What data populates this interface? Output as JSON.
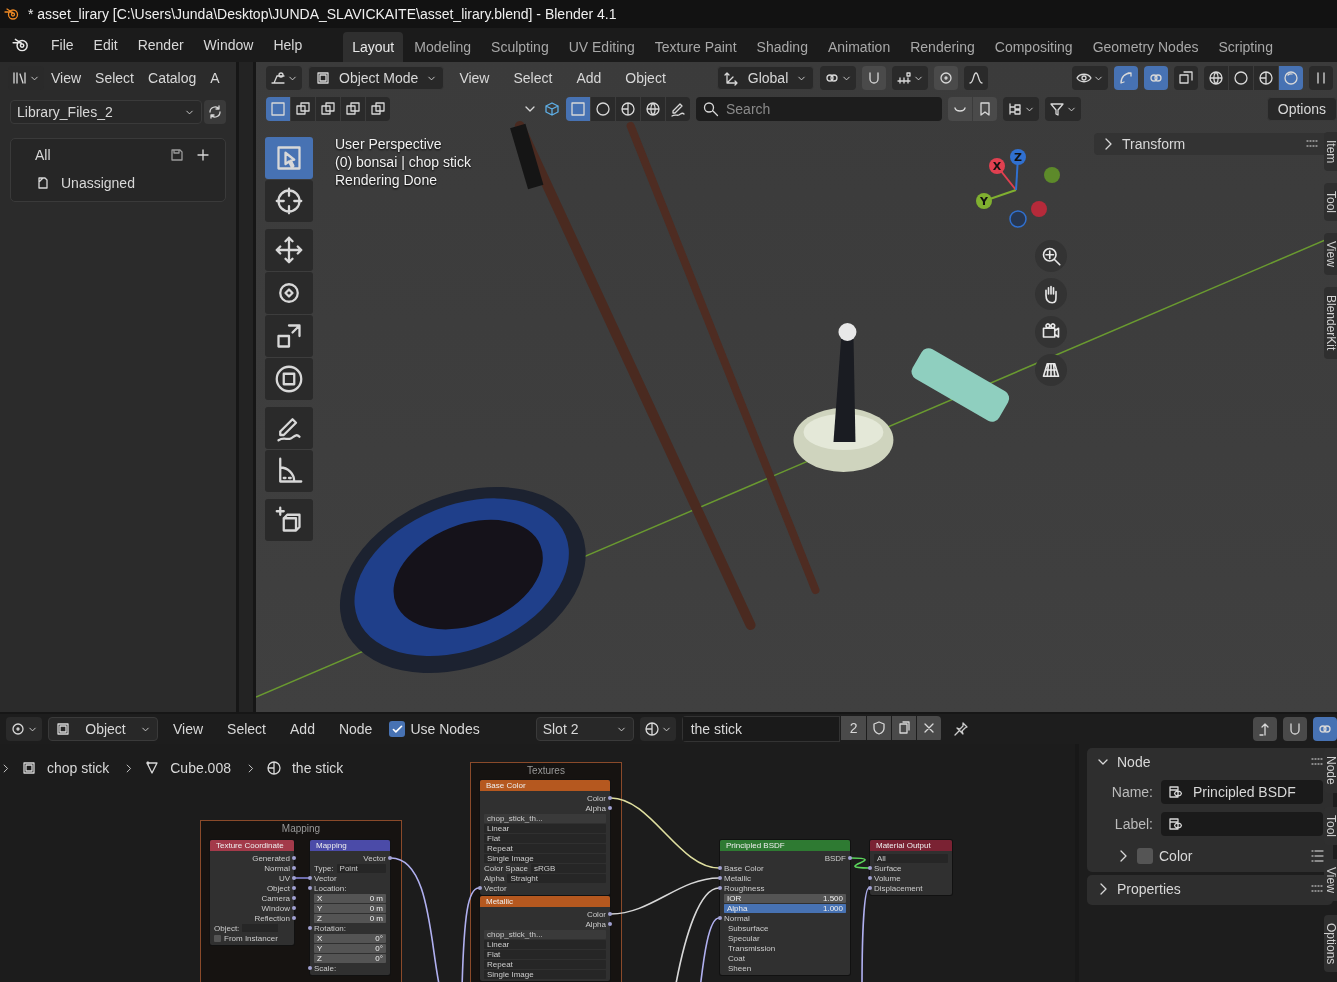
{
  "window": {
    "title": "* asset_lirary [C:\\Users\\Junda\\Desktop\\JUNDA_SLAVICKAITE\\asset_lirary.blend] - Blender 4.1"
  },
  "menu": [
    "File",
    "Edit",
    "Render",
    "Window",
    "Help"
  ],
  "workspaces": [
    {
      "label": "Layout",
      "selected": true
    },
    {
      "label": "Modeling",
      "selected": false
    },
    {
      "label": "Sculpting",
      "selected": false
    },
    {
      "label": "UV Editing",
      "selected": false
    },
    {
      "label": "Texture Paint",
      "selected": false
    },
    {
      "label": "Shading",
      "selected": false
    },
    {
      "label": "Animation",
      "selected": false
    },
    {
      "label": "Rendering",
      "selected": false
    },
    {
      "label": "Compositing",
      "selected": false
    },
    {
      "label": "Geometry Nodes",
      "selected": false
    },
    {
      "label": "Scripting",
      "selected": false
    }
  ],
  "asset_browser": {
    "menus": [
      "View",
      "Select",
      "Catalog",
      "A"
    ],
    "library": "Library_Files_2",
    "catalogs": [
      {
        "label": "All"
      },
      {
        "label": "Unassigned"
      }
    ]
  },
  "viewport": {
    "mode": "Object Mode",
    "menus": [
      "View",
      "Select",
      "Add",
      "Object"
    ],
    "orientation": "Global",
    "toggles": [
      {
        "kind": "gizmo",
        "on": true
      },
      {
        "kind": "overlay",
        "on": true
      },
      {
        "kind": "xray",
        "on": false
      }
    ],
    "shading": [
      {
        "kind": "wireframe",
        "selected": false
      },
      {
        "kind": "solid",
        "selected": false
      },
      {
        "kind": "material",
        "selected": false
      },
      {
        "kind": "rendered",
        "selected": true
      }
    ],
    "select_modes": [
      {
        "selected": true
      },
      {
        "selected": false
      },
      {
        "selected": false
      },
      {
        "selected": false
      },
      {
        "selected": false
      }
    ],
    "filters": [
      {
        "selected": true
      },
      {
        "selected": false
      },
      {
        "selected": false
      },
      {
        "selected": false
      },
      {
        "selected": false
      }
    ],
    "search": {
      "placeholder": "Search"
    },
    "options": "Options",
    "overlay_text": [
      "User Perspective",
      "(0) bonsai | chop stick",
      "Rendering Done"
    ],
    "tools": [
      {
        "kind": "select",
        "selected": true
      },
      {
        "kind": "cursor",
        "selected": false
      },
      {
        "kind": "move",
        "selected": false
      },
      {
        "kind": "rotate",
        "selected": false
      },
      {
        "kind": "scale",
        "selected": false
      },
      {
        "kind": "transform",
        "selected": false
      },
      {
        "kind": "annotate",
        "selected": false
      },
      {
        "kind": "measure",
        "selected": false
      },
      {
        "kind": "add",
        "selected": false
      }
    ],
    "gizmo_axes": [
      "X",
      "Y",
      "Z"
    ],
    "sidebar": {
      "panel": "Transform",
      "expanded": false
    },
    "tabs": [
      "Item",
      "Tool",
      "View",
      "BlenderKit"
    ]
  },
  "node_editor": {
    "type": "Object",
    "menus": [
      "View",
      "Select",
      "Add",
      "Node"
    ],
    "use_nodes": {
      "label": "Use Nodes",
      "checked": true
    },
    "slot": "Slot 2",
    "material": "the stick",
    "users": "2",
    "toggles": [
      {
        "kind": "snap",
        "on": false
      },
      {
        "kind": "overlay",
        "on": true
      }
    ],
    "breadcrumb": [
      "chop stick",
      "Cube.008",
      "the stick"
    ],
    "frames": [
      "Mapping",
      "Textures"
    ],
    "nodes": [
      {
        "title": "Texture Coordinate",
        "color": "#a33a4a",
        "rows": [
          {
            "kind": "output",
            "label": "Generated"
          },
          {
            "kind": "output",
            "label": "Normal"
          },
          {
            "kind": "output",
            "label": "UV"
          },
          {
            "kind": "output",
            "label": "Object"
          },
          {
            "kind": "output",
            "label": "Camera"
          },
          {
            "kind": "output",
            "label": "Window"
          },
          {
            "kind": "output",
            "label": "Reflection"
          },
          {
            "kind": "object",
            "label": "Object:"
          },
          {
            "kind": "check",
            "label": "From Instancer",
            "checked": false
          }
        ]
      },
      {
        "title": "Mapping",
        "color": "#4b4ba8",
        "rows": [
          {
            "kind": "output",
            "label": "Vector"
          },
          {
            "kind": "select",
            "label": "Type:",
            "value": "Point"
          },
          {
            "kind": "input",
            "label": "Vector"
          },
          {
            "kind": "input",
            "label": "Location:"
          },
          {
            "kind": "value",
            "label": "X",
            "value": "0 m"
          },
          {
            "kind": "value",
            "label": "Y",
            "value": "0 m"
          },
          {
            "kind": "value",
            "label": "Z",
            "value": "0 m"
          },
          {
            "kind": "input",
            "label": "Rotation:"
          },
          {
            "kind": "value",
            "label": "X",
            "value": "0°"
          },
          {
            "kind": "value",
            "label": "Y",
            "value": "0°"
          },
          {
            "kind": "value",
            "label": "Z",
            "value": "0°"
          },
          {
            "kind": "input",
            "label": "Scale:"
          }
        ]
      },
      {
        "title": "Base Color",
        "color": "#b5581f",
        "rows": [
          {
            "kind": "output",
            "label": "Color"
          },
          {
            "kind": "output",
            "label": "Alpha"
          },
          {
            "kind": "image",
            "value": "chop_stick_th..."
          },
          {
            "kind": "select",
            "value": "Linear"
          },
          {
            "kind": "select",
            "value": "Flat"
          },
          {
            "kind": "select",
            "value": "Repeat"
          },
          {
            "kind": "select",
            "value": "Single Image"
          },
          {
            "kind": "select",
            "label": "Color Space",
            "value": "sRGB"
          },
          {
            "kind": "select",
            "label": "Alpha",
            "value": "Straight"
          },
          {
            "kind": "input",
            "label": "Vector"
          }
        ]
      },
      {
        "title": "Metallic",
        "color": "#b5581f",
        "rows": [
          {
            "kind": "output",
            "label": "Color"
          },
          {
            "kind": "output",
            "label": "Alpha"
          },
          {
            "kind": "image",
            "value": "chop_stick_th..."
          },
          {
            "kind": "select",
            "value": "Linear"
          },
          {
            "kind": "select",
            "value": "Flat"
          },
          {
            "kind": "select",
            "value": "Repeat"
          },
          {
            "kind": "select",
            "value": "Single Image"
          }
        ]
      },
      {
        "title": "Principled BSDF",
        "color": "#2e7a32",
        "rows": [
          {
            "kind": "output",
            "label": "BSDF"
          },
          {
            "kind": "input",
            "label": "Base Color"
          },
          {
            "kind": "input",
            "label": "Metallic"
          },
          {
            "kind": "input",
            "label": "Roughness"
          },
          {
            "kind": "value",
            "label": "IOR",
            "value": "1.500"
          },
          {
            "kind": "value",
            "label": "Alpha",
            "value": "1.000",
            "level": 1
          },
          {
            "kind": "input",
            "label": "Normal"
          },
          {
            "kind": "panel",
            "label": "Subsurface"
          },
          {
            "kind": "panel",
            "label": "Specular"
          },
          {
            "kind": "panel",
            "label": "Transmission"
          },
          {
            "kind": "panel",
            "label": "Coat"
          },
          {
            "kind": "panel",
            "label": "Sheen"
          }
        ]
      },
      {
        "title": "Material Output",
        "color": "#7a2233",
        "rows": [
          {
            "kind": "select",
            "value": "All"
          },
          {
            "kind": "input",
            "label": "Surface"
          },
          {
            "kind": "input",
            "label": "Volume"
          },
          {
            "kind": "input",
            "label": "Displacement"
          }
        ]
      }
    ],
    "panel": {
      "title": "Node",
      "expanded": true,
      "fields": [
        {
          "label": "Name:",
          "value": "Principled BSDF"
        },
        {
          "label": "Label:"
        }
      ],
      "color": {
        "label": "Color",
        "checked": false,
        "expanded": false
      },
      "properties": {
        "title": "Properties",
        "expanded": false
      }
    },
    "tabs": [
      "Node",
      "Tool",
      "View",
      "Options"
    ]
  }
}
